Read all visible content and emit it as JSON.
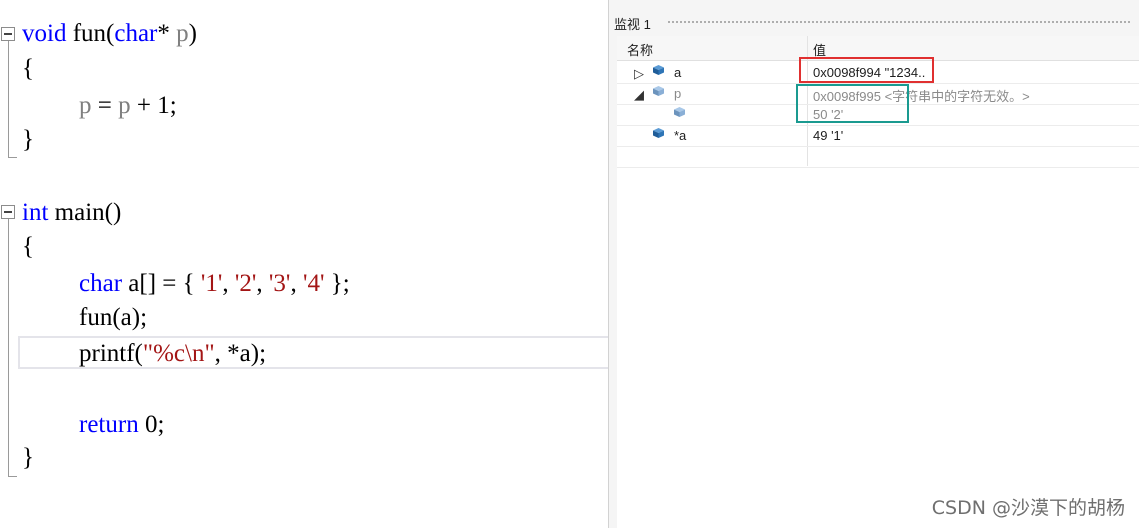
{
  "editor": {
    "lines": {
      "l1": {
        "kw1": "void",
        "mid": " fun(",
        "kw2": "char",
        "star": "* ",
        "param": "p",
        "end": ")"
      },
      "l2": {
        "text": "{"
      },
      "l3": {
        "p1": "p",
        "mid": " = ",
        "p2": "p",
        "end": " + 1;"
      },
      "l4": {
        "text": "}"
      },
      "l5": {
        "kw": "int",
        "rest": " main()"
      },
      "l6": {
        "text": "{"
      },
      "l7": {
        "kw": "char",
        "a": " a[] = { ",
        "s1": "'1'",
        "c1": ", ",
        "s2": "'2'",
        "c2": ", ",
        "s3": "'3'",
        "c3": ", ",
        "s4": "'4'",
        "end": " };"
      },
      "l8": {
        "text": "fun(a);"
      },
      "l9": {
        "fn": "printf(",
        "str": "\"%c\\n\"",
        "end": ", *a);"
      },
      "l10": {
        "kw": "return",
        "end": " 0;"
      },
      "l11": {
        "text": "}"
      }
    }
  },
  "watch": {
    "title": "监视 1",
    "columns": {
      "name": "名称",
      "value": "值"
    },
    "rows": [
      {
        "expander": "▷",
        "name": "a",
        "value": "0x0098f994 \"1234..",
        "icon": "variable-cube-icon"
      },
      {
        "expander": "◢",
        "name": "p",
        "value": "0x0098f995 <字符串中的字符无效。>",
        "icon": "variable-cube-icon"
      },
      {
        "expander": "",
        "name": "",
        "value": "50 '2'",
        "icon": "variable-cube-icon"
      },
      {
        "expander": "",
        "name": "*a",
        "value": "49 '1'",
        "icon": "variable-cube-icon"
      }
    ]
  },
  "watermark": "CSDN @沙漠下的胡杨",
  "colors": {
    "keyword": "#0000ff",
    "param": "#808080",
    "string": "#a31515",
    "highlight_red": "#e03030",
    "highlight_teal": "#1a9a90"
  }
}
